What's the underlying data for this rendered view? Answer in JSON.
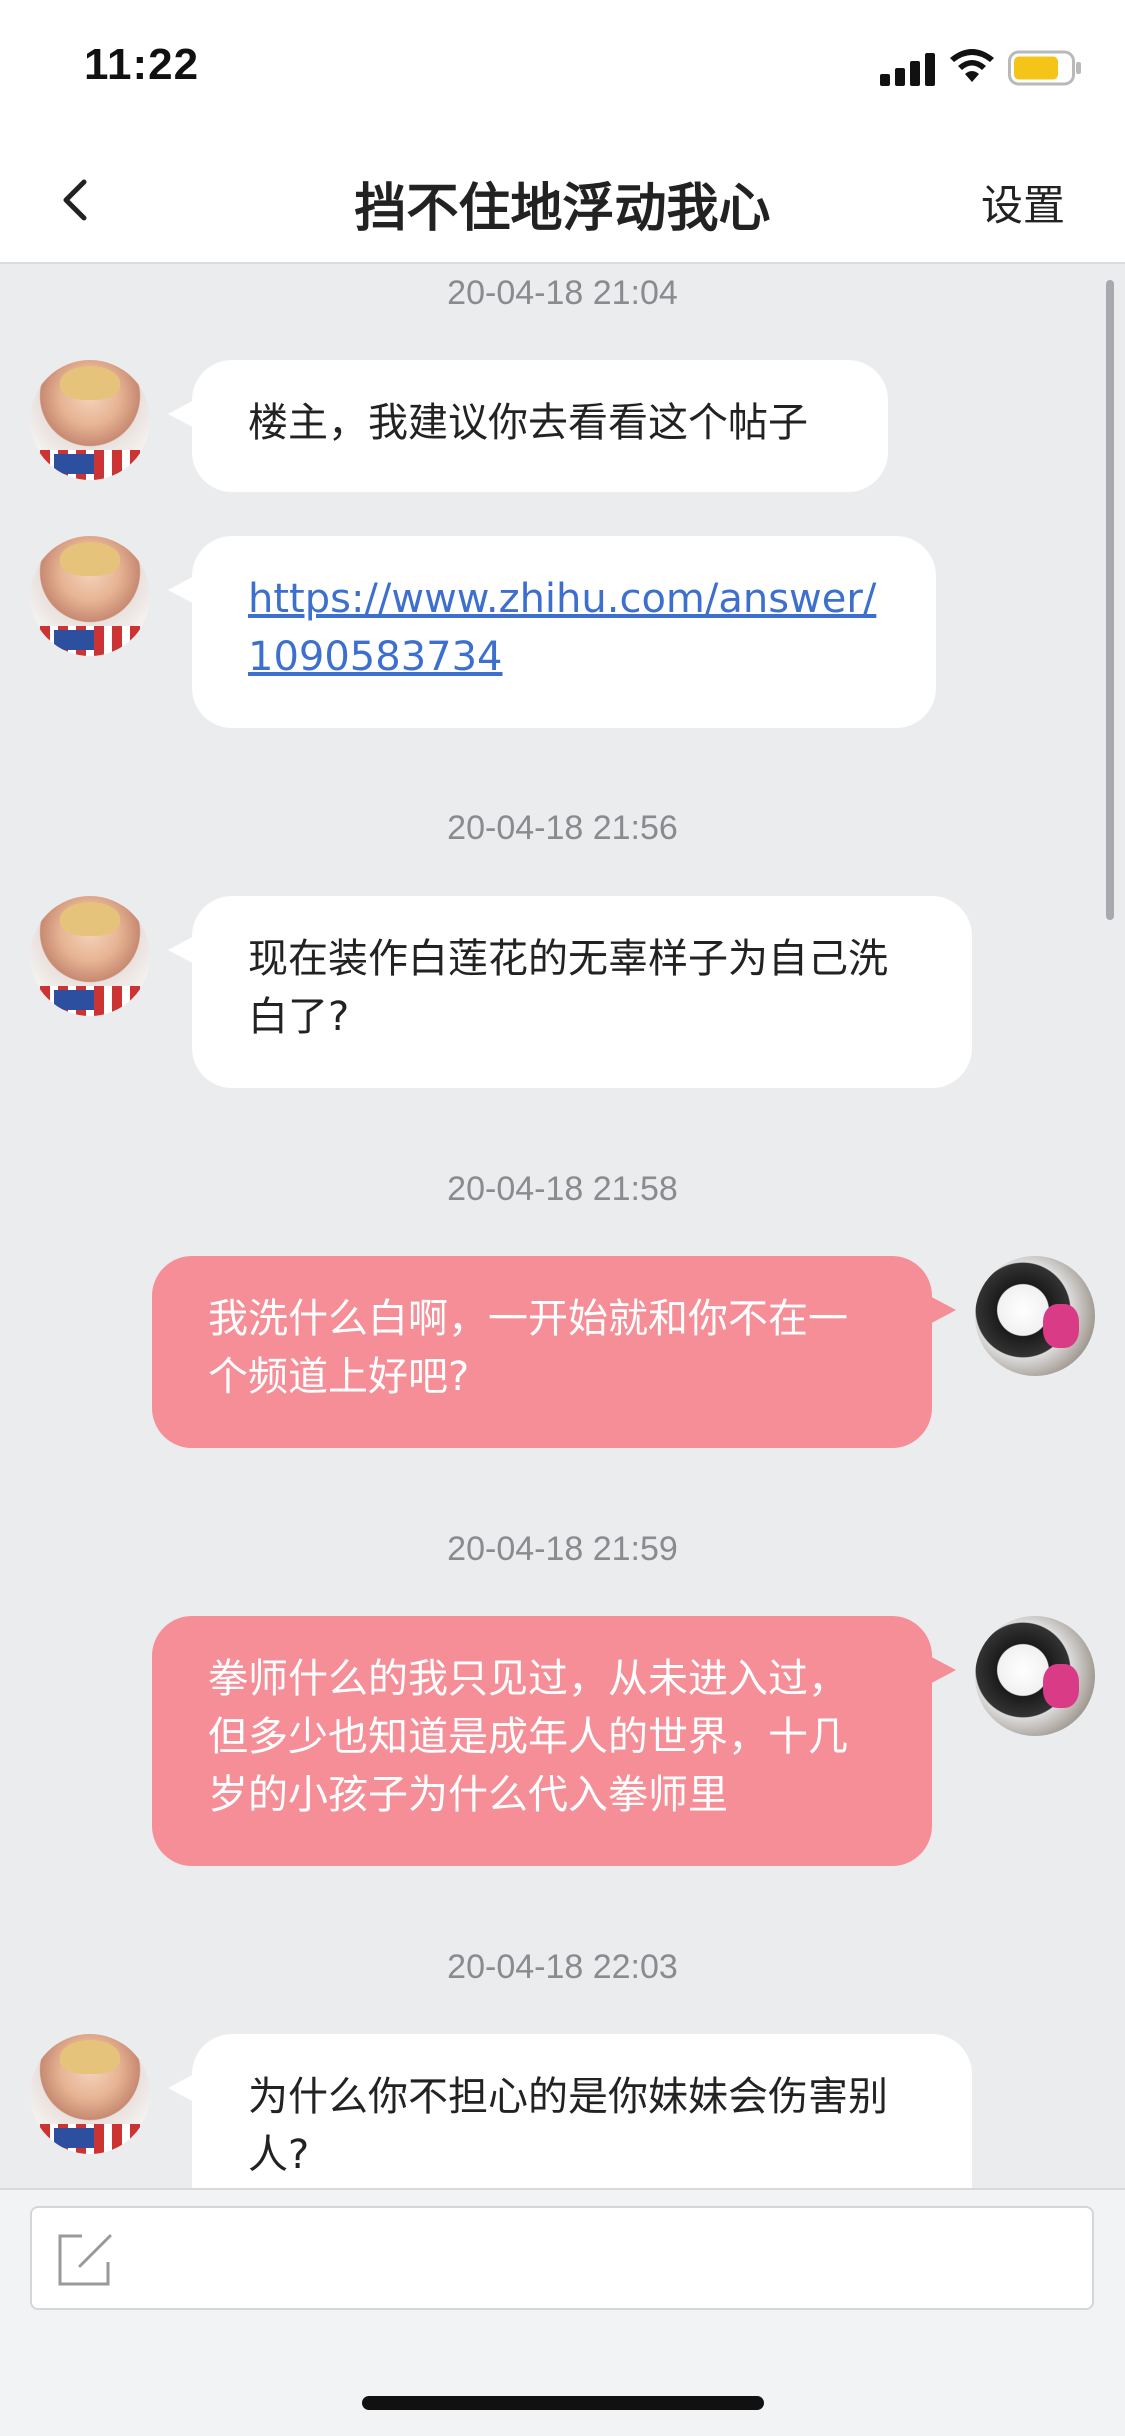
{
  "status_bar": {
    "time": "11:22",
    "icons": [
      "signal-icon",
      "wifi-icon",
      "battery-icon"
    ],
    "battery_color": "#f4c518"
  },
  "nav": {
    "back_icon": "chevron-left-icon",
    "title": "挡不住地浮动我心",
    "settings_label": "设置"
  },
  "colors": {
    "background": "#ebecee",
    "other_bubble": "#ffffff",
    "self_bubble": "#f58e97",
    "link": "#3d6fcf"
  },
  "messages": {
    "ts1": "20-04-18 21:04",
    "m1": "楼主，我建议你去看看这个帖子",
    "m2_link_line1": "https://www.zhihu.com/answer/",
    "m2_link_line2": "1090583734",
    "ts2": "20-04-18 21:56",
    "m3_line1": "现在装作白莲花的无辜样子为自己洗",
    "m3_line2": "白了?",
    "ts3": "20-04-18 21:58",
    "m4_line1": "我洗什么白啊，一开始就和你不在一",
    "m4_line2": "个频道上好吧?",
    "ts4": "20-04-18 21:59",
    "m5_line1": "拳师什么的我只见过，从未进入过，",
    "m5_line2": "但多少也知道是成年人的世界，十几",
    "m5_line3": "岁的小孩子为什么代入拳师里",
    "ts5": "20-04-18 22:03",
    "m6_line1": "为什么你不担心的是你妹妹会伤害别",
    "m6_line2": "人?"
  },
  "input": {
    "icon": "compose-icon",
    "placeholder": ""
  }
}
